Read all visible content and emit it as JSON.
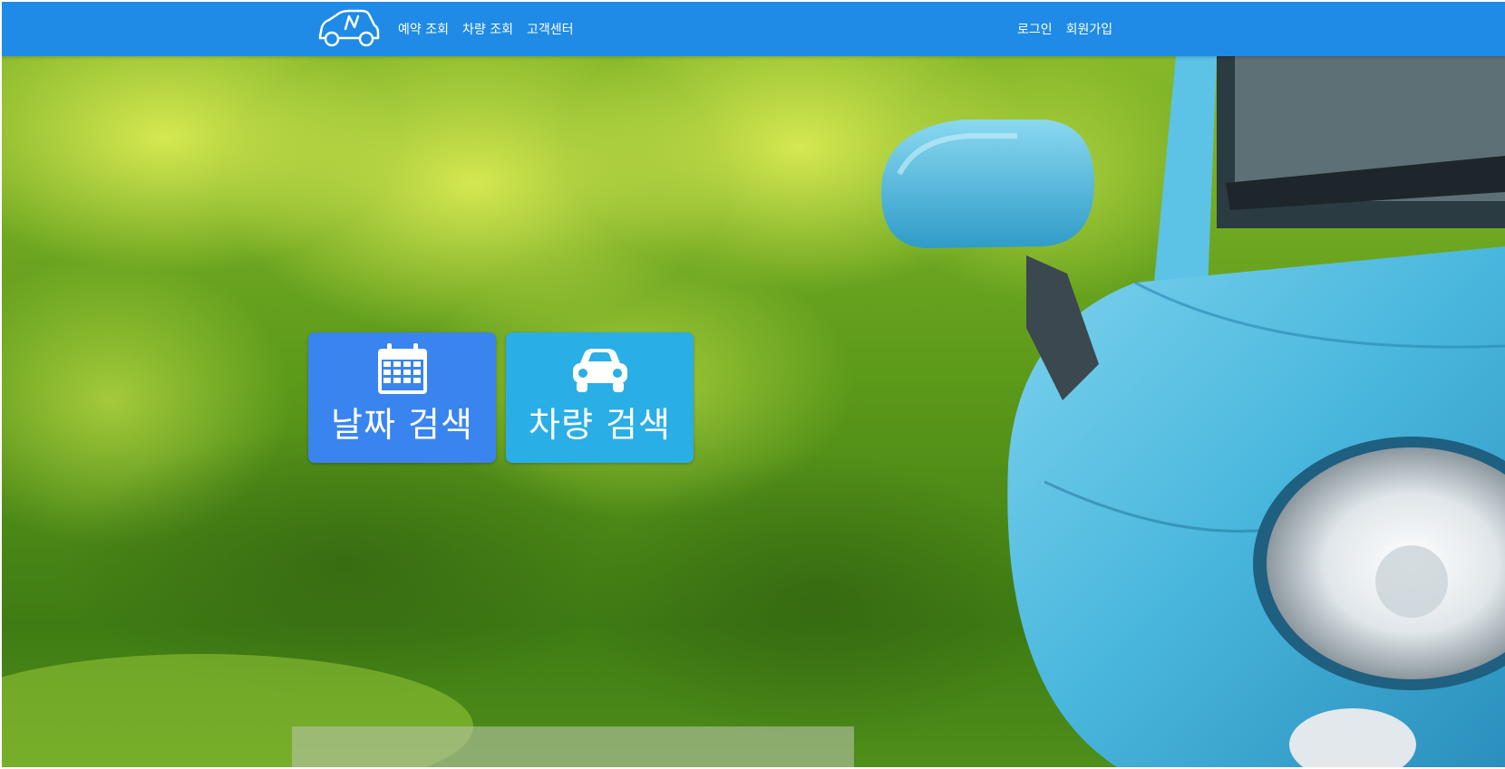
{
  "header": {
    "logo_icon": "car-logo-icon",
    "nav_left": [
      {
        "label": "예약 조회"
      },
      {
        "label": "차량 조회"
      },
      {
        "label": "고객센터"
      }
    ],
    "nav_right": [
      {
        "label": "로그인"
      },
      {
        "label": "회원가입"
      }
    ],
    "colors": {
      "navbar": "#1f8be6"
    }
  },
  "hero": {
    "background_image": "blue-car-side-mirror-green-bokeh",
    "tiles": [
      {
        "label": "날짜 검색",
        "icon": "calendar-icon",
        "color": "#3a84f0"
      },
      {
        "label": "차량 검색",
        "icon": "car-icon",
        "color": "#2aaee6"
      }
    ]
  }
}
